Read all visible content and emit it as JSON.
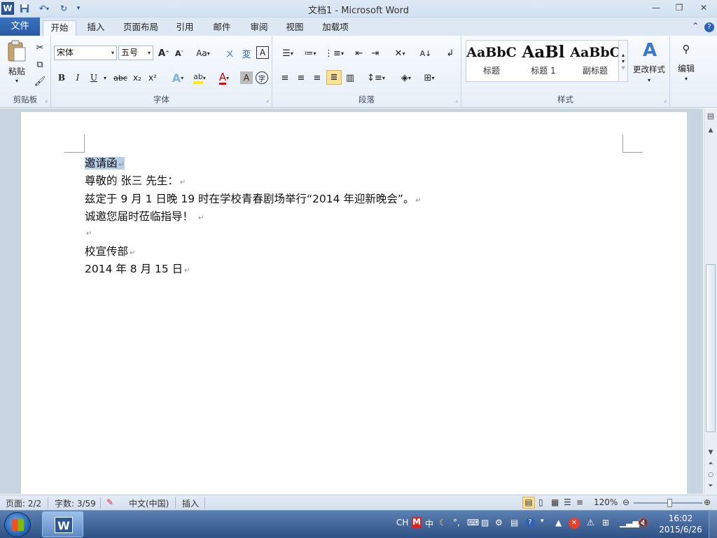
{
  "app": {
    "title": "文档1 - Microsoft Word"
  },
  "titlebar": {
    "minimize": "—",
    "restore": "❐",
    "close": "✕",
    "logo": "W"
  },
  "tabs": {
    "file": "文件",
    "items": [
      "开始",
      "插入",
      "页面布局",
      "引用",
      "邮件",
      "审阅",
      "视图",
      "加载项"
    ]
  },
  "ribbon": {
    "clipboard": {
      "label": "剪贴板",
      "paste": "粘贴"
    },
    "font": {
      "label": "字体",
      "font_name": "宋体",
      "font_size": "五号",
      "grow": "A",
      "shrink": "A",
      "case": "Aa",
      "bold": "B",
      "italic": "I",
      "underline": "U",
      "strike": "abc",
      "sub": "x₂",
      "sup": "x²",
      "clear": "A"
    },
    "paragraph": {
      "label": "段落"
    },
    "styles": {
      "label": "样式",
      "items": [
        {
          "sample": "AaBbC",
          "name": "标题"
        },
        {
          "sample": "AaBl",
          "name": "标题 1"
        },
        {
          "sample": "AaBbC",
          "name": "副标题"
        }
      ],
      "change_styles": "更改样式"
    },
    "editing": {
      "label": "编辑"
    }
  },
  "document": {
    "lines": [
      "邀请函",
      "尊敬的  张三  先生：",
      "兹定于 9 月 1 日晚 19 时在学校青春剧场举行“2014 年迎新晚会”。",
      "诚邀您届时莅临指导！ ",
      "",
      "校宣传部",
      "2014 年 8 月 15 日"
    ],
    "paragraph_mark": "↵"
  },
  "statusbar": {
    "page": "页面: 2/2",
    "words": "字数: 3/59",
    "language": "中文(中国)",
    "mode": "插入",
    "zoom": "120%"
  },
  "taskbar": {
    "ime": "CH",
    "time": "16:02",
    "date": "2015/6/26"
  },
  "colors": {
    "accent": "#2b5797",
    "selection": "#b7cde8"
  }
}
